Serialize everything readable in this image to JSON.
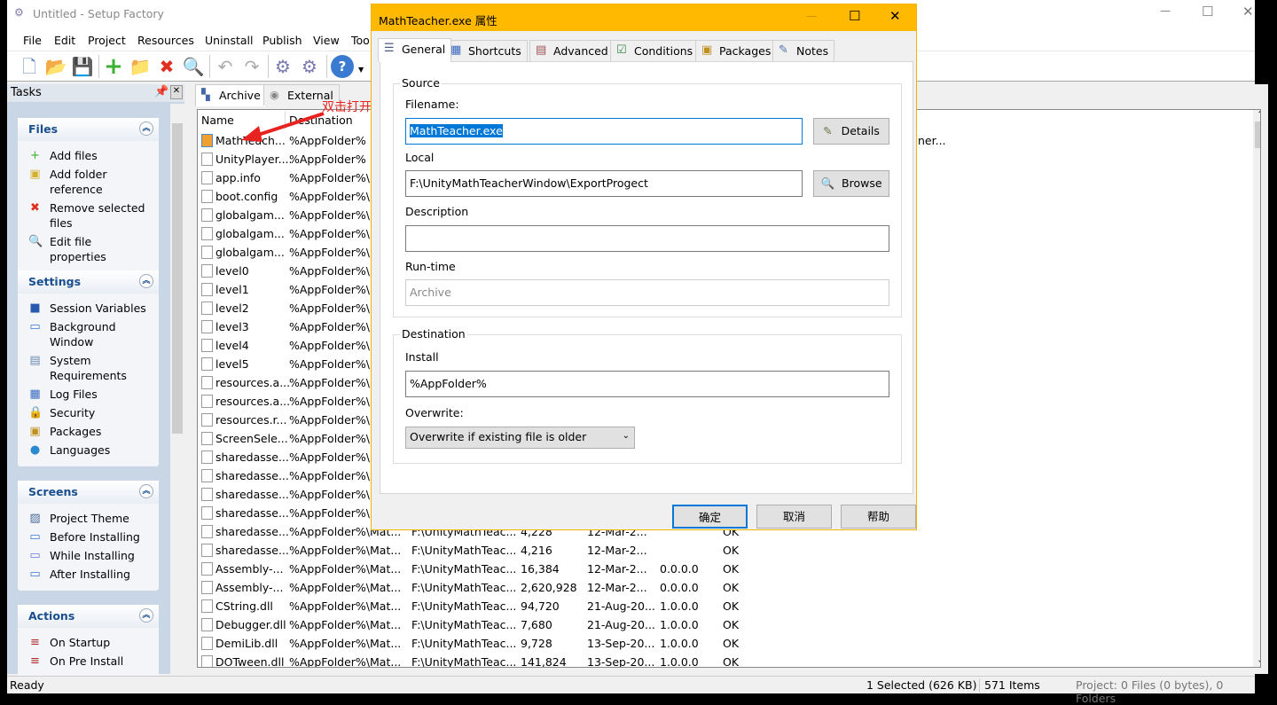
{
  "window": {
    "title": "Untitled - Setup Factory",
    "menu": [
      "File",
      "Edit",
      "Project",
      "Resources",
      "Uninstall",
      "Publish",
      "View",
      "Too"
    ]
  },
  "toolbar": [
    "new-project-icon",
    "open-icon",
    "save-icon",
    "add-files-icon",
    "add-folder-icon",
    "remove-icon",
    "properties-icon",
    "undo-icon",
    "redo-icon",
    "build-settings-icon",
    "build-icon",
    "help-icon"
  ],
  "tasks": {
    "title": "Tasks",
    "groups": [
      {
        "title": "Files",
        "items": [
          [
            "Add files",
            "+"
          ],
          [
            "Add folder reference",
            "▣"
          ],
          [
            "Remove selected files",
            "✖"
          ],
          [
            "Edit file properties",
            "🔍"
          ]
        ]
      },
      {
        "title": "Settings",
        "items": [
          [
            "Session Variables",
            "■"
          ],
          [
            "Background Window",
            "▭"
          ],
          [
            "System Requirements",
            "▤"
          ],
          [
            "Log Files",
            "▦"
          ],
          [
            "Security",
            "🔒"
          ],
          [
            "Packages",
            "▣"
          ],
          [
            "Languages",
            "●"
          ]
        ]
      },
      {
        "title": "Screens",
        "items": [
          [
            "Project Theme",
            "▨"
          ],
          [
            "Before Installing",
            "▭"
          ],
          [
            "While Installing",
            "▭"
          ],
          [
            "After Installing",
            "▭"
          ]
        ]
      },
      {
        "title": "Actions",
        "items": [
          [
            "On Startup",
            "≡"
          ],
          [
            "On Pre Install",
            "≡"
          ]
        ]
      }
    ]
  },
  "tabs": [
    "Archive",
    "External"
  ],
  "list": {
    "headers": [
      "Name",
      "Destination"
    ],
    "rows": [
      [
        "MathTeach...",
        "%AppFolder%",
        "",
        "",
        "",
        "",
        "",
        "ner..."
      ],
      [
        "UnityPlayer....",
        "%AppFolder%"
      ],
      [
        "app.info",
        "%AppFolder%\\M"
      ],
      [
        "boot.config",
        "%AppFolder%\\M"
      ],
      [
        "globalgam...",
        "%AppFolder%\\M"
      ],
      [
        "globalgam...",
        "%AppFolder%\\M"
      ],
      [
        "globalgam...",
        "%AppFolder%\\M"
      ],
      [
        "level0",
        "%AppFolder%\\M"
      ],
      [
        "level1",
        "%AppFolder%\\M"
      ],
      [
        "level2",
        "%AppFolder%\\M"
      ],
      [
        "level3",
        "%AppFolder%\\M"
      ],
      [
        "level4",
        "%AppFolder%\\M"
      ],
      [
        "level5",
        "%AppFolder%\\M"
      ],
      [
        "resources.a...",
        "%AppFolder%\\M"
      ],
      [
        "resources.a...",
        "%AppFolder%\\M"
      ],
      [
        "resources.r...",
        "%AppFolder%\\M"
      ],
      [
        "ScreenSele...",
        "%AppFolder%\\M"
      ],
      [
        "sharedasse...",
        "%AppFolder%\\M"
      ],
      [
        "sharedasse...",
        "%AppFolder%\\M"
      ],
      [
        "sharedasse...",
        "%AppFolder%\\M"
      ],
      [
        "sharedasse...",
        "%AppFolder%\\M"
      ],
      [
        "sharedasse...",
        "%AppFolder%\\Mat...",
        "F:\\UnityMathTeac...",
        "4,228",
        "12-Mar-2...",
        "",
        "OK"
      ],
      [
        "sharedasse...",
        "%AppFolder%\\Mat...",
        "F:\\UnityMathTeac...",
        "4,216",
        "12-Mar-2...",
        "",
        "OK"
      ],
      [
        "Assembly-...",
        "%AppFolder%\\Mat...",
        "F:\\UnityMathTeac...",
        "16,384",
        "12-Mar-2...",
        "0.0.0.0",
        "OK"
      ],
      [
        "Assembly-...",
        "%AppFolder%\\Mat...",
        "F:\\UnityMathTeac...",
        "2,620,928",
        "12-Mar-2...",
        "0.0.0.0",
        "OK"
      ],
      [
        "CString.dll",
        "%AppFolder%\\Mat...",
        "F:\\UnityMathTeac...",
        "94,720",
        "21-Aug-20...",
        "1.0.0.0",
        "OK"
      ],
      [
        "Debugger.dll",
        "%AppFolder%\\Mat...",
        "F:\\UnityMathTeac...",
        "7,680",
        "21-Aug-20...",
        "1.0.0.0",
        "OK"
      ],
      [
        "DemiLib.dll",
        "%AppFolder%\\Mat...",
        "F:\\UnityMathTeac...",
        "9,728",
        "13-Sep-20...",
        "1.0.0.0",
        "OK"
      ],
      [
        "DOTween.dll",
        "%AppFolder%\\Mat...",
        "F:\\UnityMathTeac...",
        "141,824",
        "13-Sep-20...",
        "1.0.0.0",
        "OK"
      ]
    ]
  },
  "annotation": {
    "text": "双击打开属性",
    "color": "#e8231f"
  },
  "status": {
    "ready": "Ready",
    "selected": "1 Selected (626 KB)",
    "items": "571 Items",
    "project": "Project: 0 Files (0 bytes), 0 Folders"
  },
  "dialog": {
    "title": "MathTeacher.exe 属性",
    "accent": "#ffb900",
    "tabs": [
      "General",
      "Shortcuts",
      "Advanced",
      "Conditions",
      "Packages",
      "Notes"
    ],
    "source": {
      "title": "Source",
      "filename_label": "Filename:",
      "filename": "MathTeacher.exe",
      "details": "Details",
      "local_label": "Local",
      "local": "F:\\UnityMathTeacherWindow\\ExportProgect",
      "browse": "Browse",
      "description_label": "Description",
      "description": "",
      "runtime_label": "Run-time",
      "runtime": "Archive"
    },
    "destination": {
      "title": "Destination",
      "install_label": "Install",
      "install": "%AppFolder%",
      "overwrite_label": "Overwrite:",
      "overwrite": "Overwrite if existing file is older"
    },
    "buttons": {
      "ok": "确定",
      "cancel": "取消",
      "help": "帮助"
    }
  }
}
